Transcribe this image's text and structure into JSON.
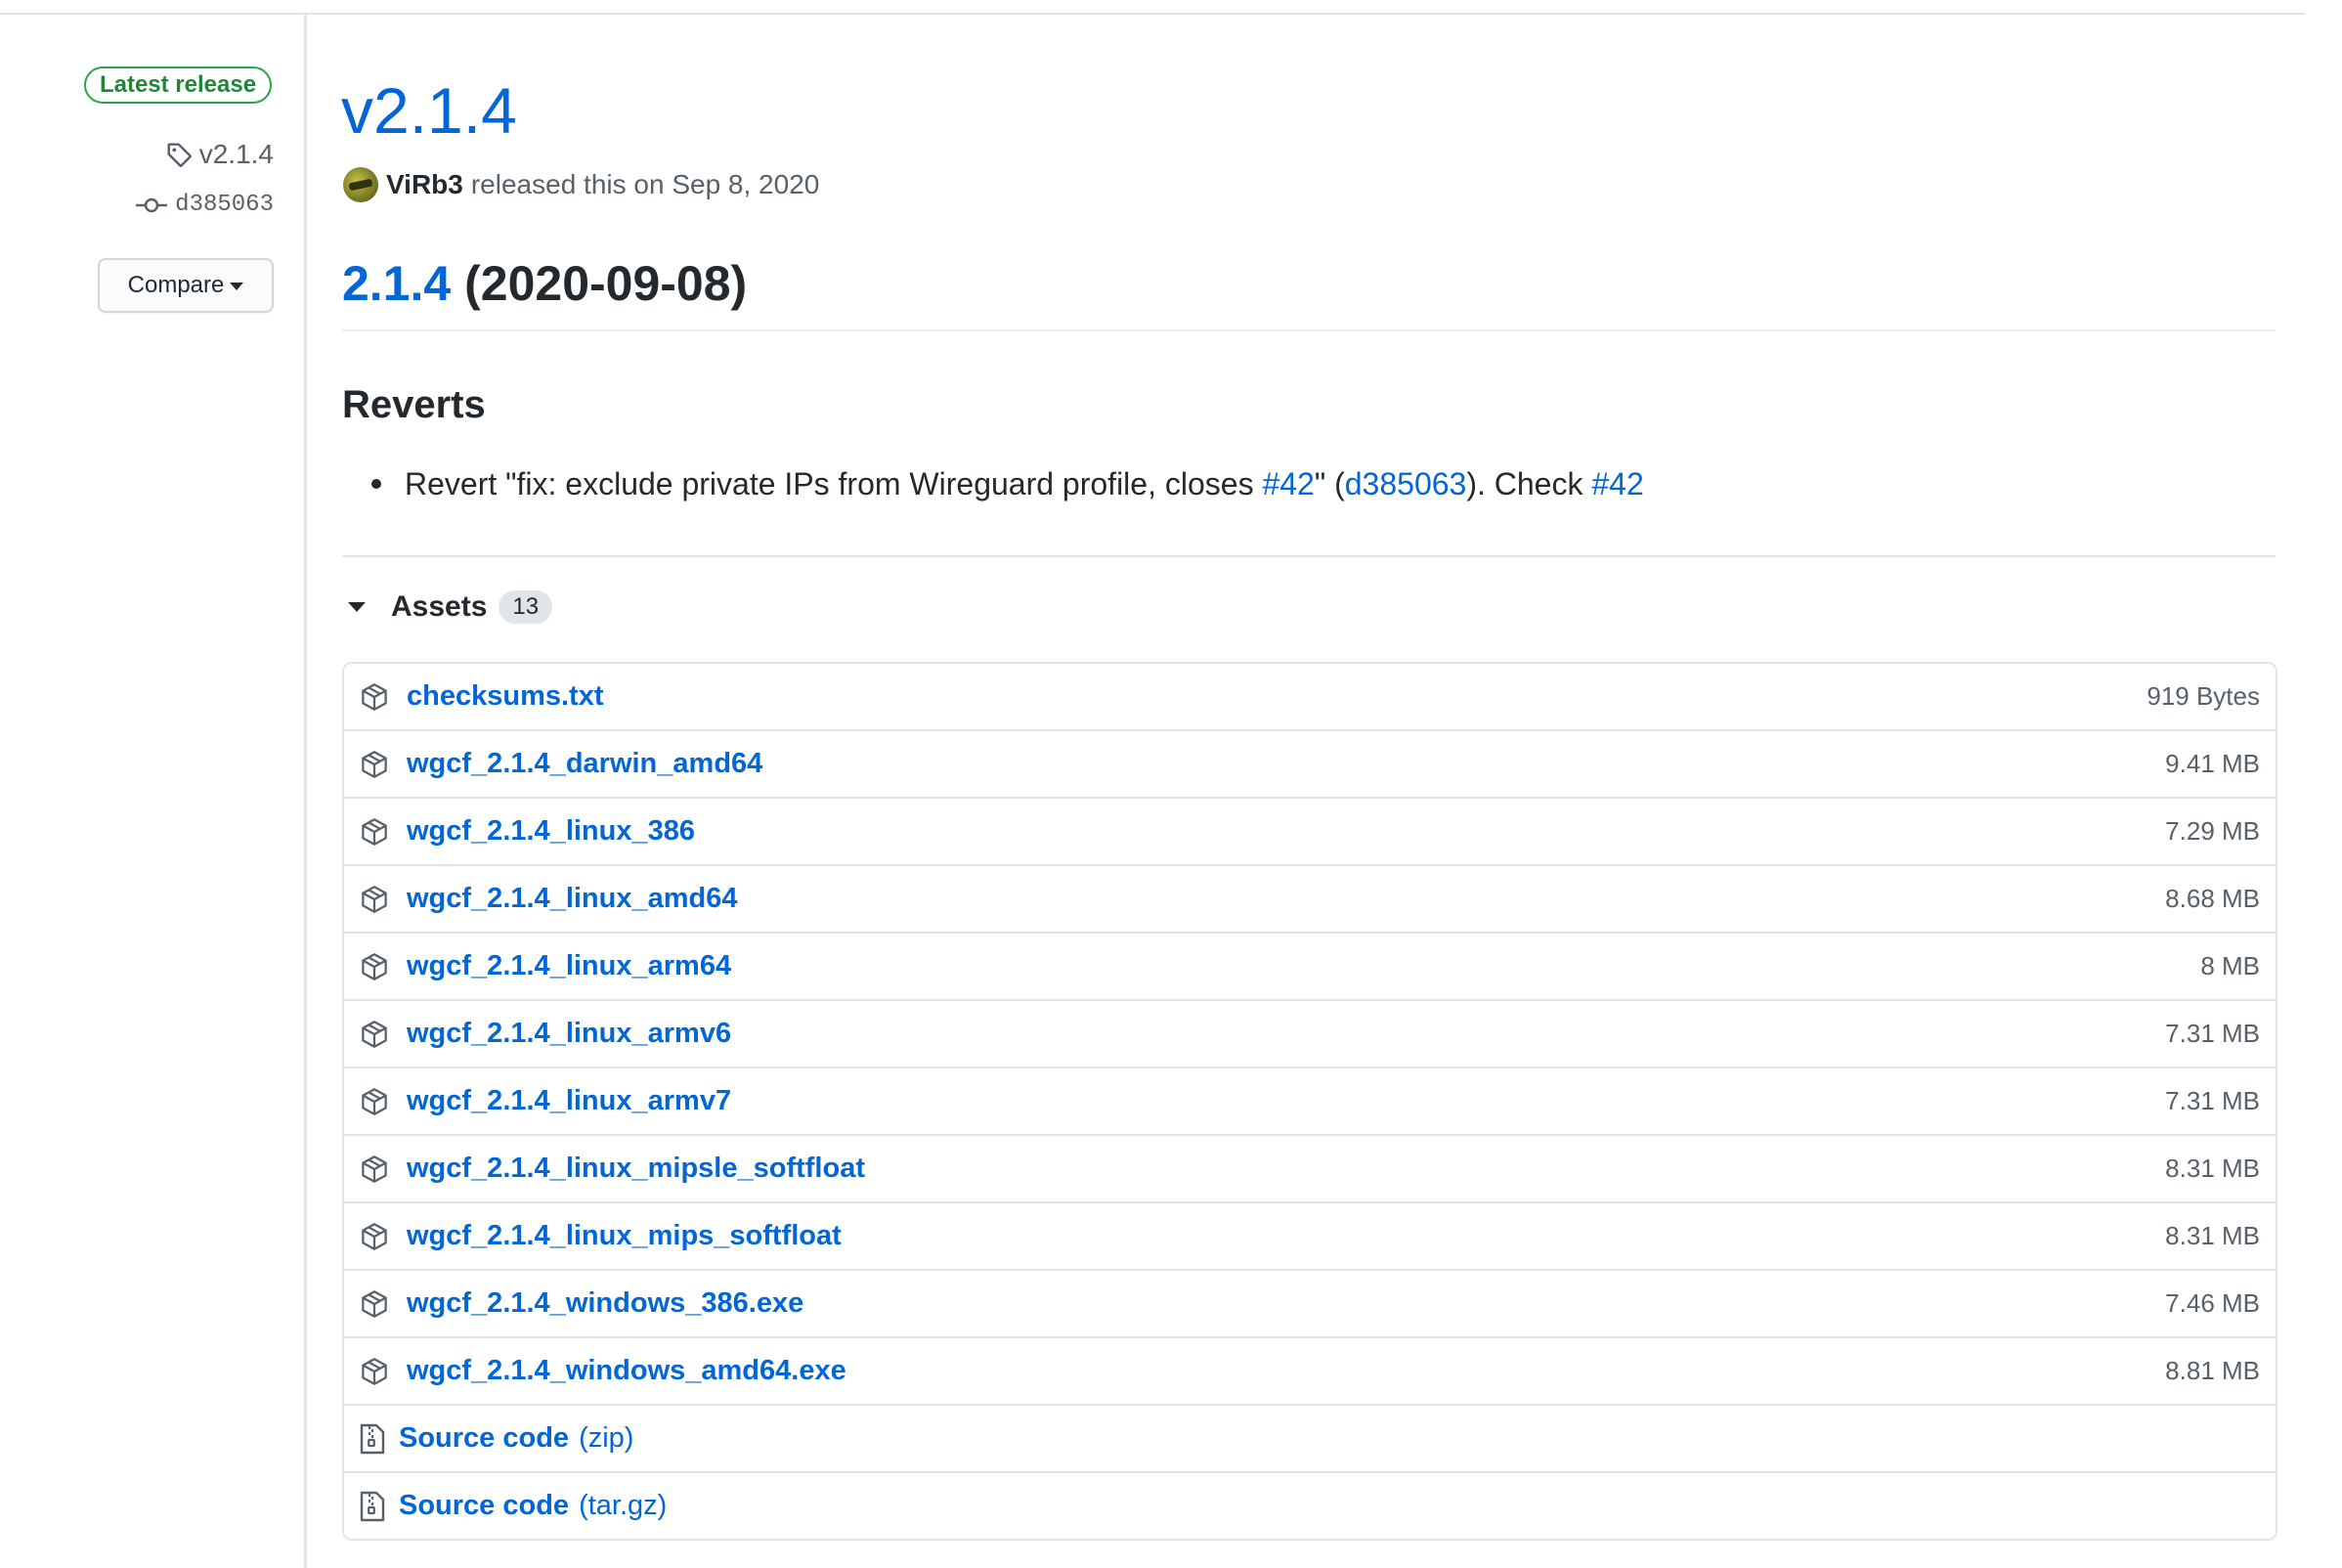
{
  "sidebar": {
    "latest_badge": "Latest release",
    "tag": "v2.1.4",
    "commit": "d385063",
    "compare_label": "Compare"
  },
  "release": {
    "title": "v2.1.4",
    "author": "ViRb3",
    "released_text": "released this on Sep 8, 2020"
  },
  "notes": {
    "version_link": "2.1.4",
    "version_date": "(2020-09-08)",
    "section_heading": "Reverts",
    "bullet": {
      "text_1": "Revert \"fix: exclude private IPs from Wireguard profile, closes ",
      "link_1": "#42",
      "text_2": "\" (",
      "link_2": "d385063",
      "text_3": "). Check ",
      "link_3": "#42"
    }
  },
  "assets": {
    "label": "Assets",
    "count": "13",
    "items": [
      {
        "name": "checksums.txt",
        "size": "919 Bytes"
      },
      {
        "name": "wgcf_2.1.4_darwin_amd64",
        "size": "9.41 MB"
      },
      {
        "name": "wgcf_2.1.4_linux_386",
        "size": "7.29 MB"
      },
      {
        "name": "wgcf_2.1.4_linux_amd64",
        "size": "8.68 MB"
      },
      {
        "name": "wgcf_2.1.4_linux_arm64",
        "size": "8 MB"
      },
      {
        "name": "wgcf_2.1.4_linux_armv6",
        "size": "7.31 MB"
      },
      {
        "name": "wgcf_2.1.4_linux_armv7",
        "size": "7.31 MB"
      },
      {
        "name": "wgcf_2.1.4_linux_mipsle_softfloat",
        "size": "8.31 MB"
      },
      {
        "name": "wgcf_2.1.4_linux_mips_softfloat",
        "size": "8.31 MB"
      },
      {
        "name": "wgcf_2.1.4_windows_386.exe",
        "size": "7.46 MB"
      },
      {
        "name": "wgcf_2.1.4_windows_amd64.exe",
        "size": "8.81 MB"
      }
    ],
    "source": [
      {
        "name": "Source code",
        "ext": "(zip)"
      },
      {
        "name": "Source code",
        "ext": "(tar.gz)"
      }
    ]
  },
  "colors": {
    "link": "#0366d6",
    "badge_green": "#28a745",
    "muted": "#586069",
    "border": "#e1e4e8"
  },
  "icons": {
    "tag": "tag-icon",
    "commit": "git-commit-icon",
    "asset": "package-icon",
    "source": "file-zip-icon",
    "caret": "triangle-down-icon"
  }
}
